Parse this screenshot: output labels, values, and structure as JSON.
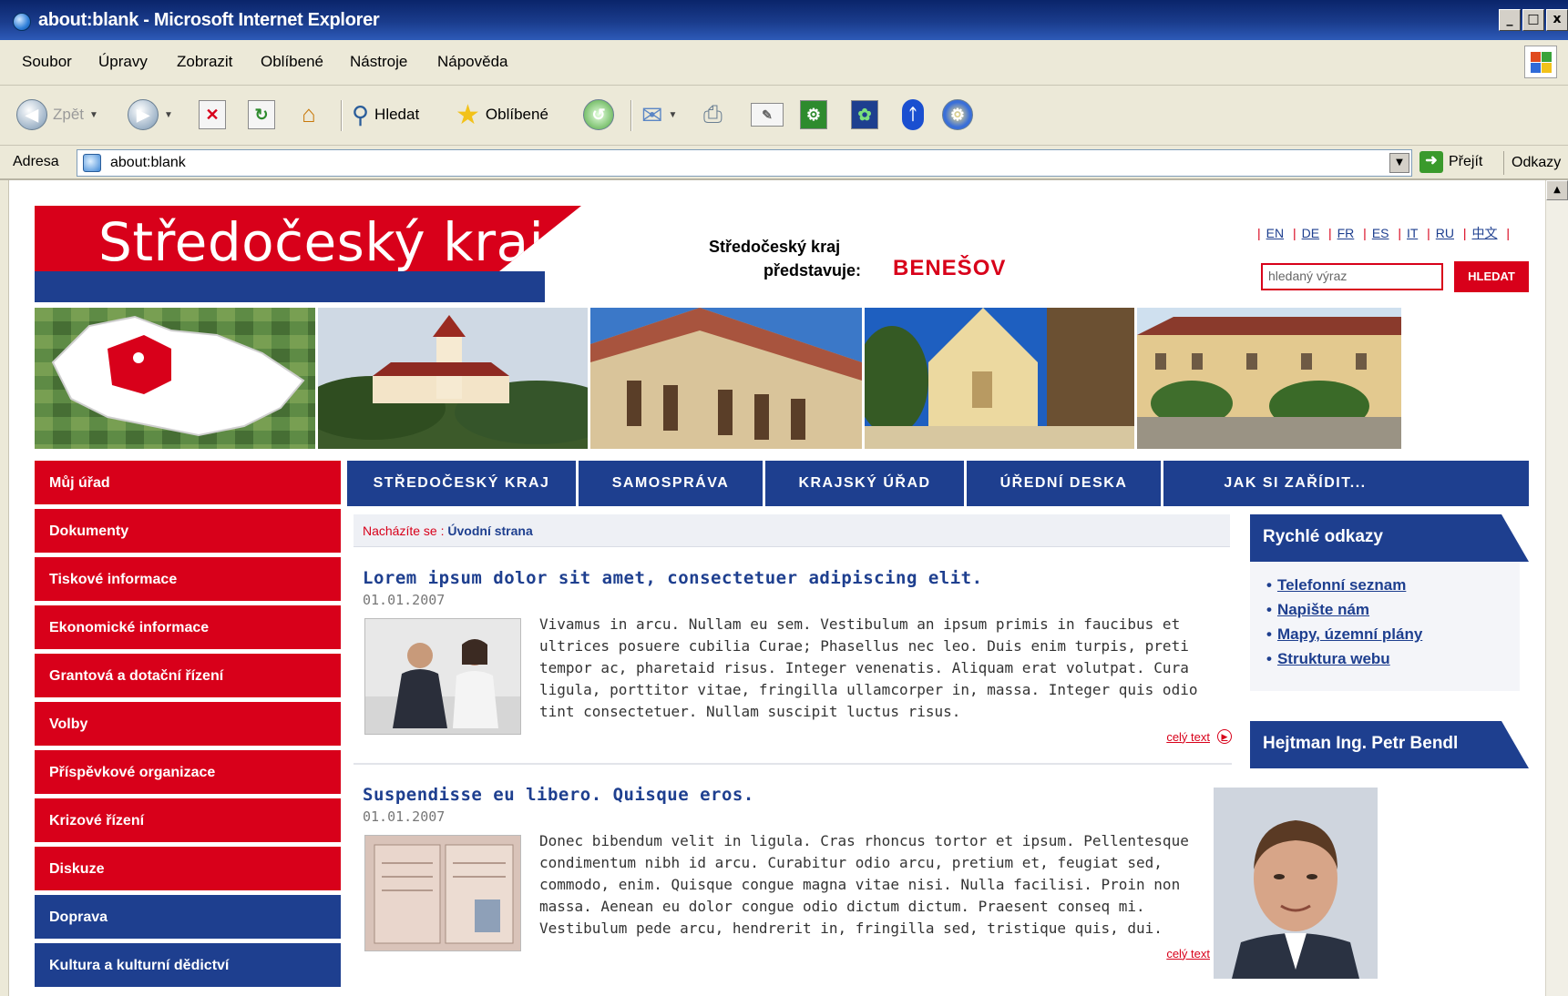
{
  "window": {
    "title": "about:blank - Microsoft Internet Explorer",
    "controls": [
      "_",
      "□",
      "x"
    ]
  },
  "menu": [
    "Soubor",
    "Úpravy",
    "Zobrazit",
    "Oblíbené",
    "Nástroje",
    "Nápověda"
  ],
  "toolbar": {
    "back_label": "Zpět",
    "search_label": "Hledat",
    "favorites_label": "Oblíbené"
  },
  "address": {
    "label": "Adresa",
    "value": "about:blank",
    "go_label": "Přejít",
    "links_label": "Odkazy"
  },
  "site": {
    "logo_text": "Středočeský kraj",
    "presents_line1": "Středočeský kraj",
    "presents_line2": "představuje:",
    "city": "BENEŠOV",
    "languages": [
      "EN",
      "DE",
      "FR",
      "ES",
      "IT",
      "RU",
      "中文"
    ],
    "search_placeholder": "hledaný výraz",
    "search_button": "HLEDAT",
    "left_nav": [
      {
        "label": "Můj úřad",
        "color": "red"
      },
      {
        "label": "Dokumenty",
        "color": "red"
      },
      {
        "label": "Tiskové informace",
        "color": "red"
      },
      {
        "label": "Ekonomické informace",
        "color": "red"
      },
      {
        "label": "Grantová a dotační řízení",
        "color": "red"
      },
      {
        "label": "Volby",
        "color": "red"
      },
      {
        "label": "Příspěvkové organizace",
        "color": "red"
      },
      {
        "label": "Krizové řízení",
        "color": "red"
      },
      {
        "label": "Diskuze",
        "color": "red"
      },
      {
        "label": "Doprava",
        "color": "blue"
      },
      {
        "label": "Kultura a kulturní dědictví",
        "color": "blue"
      }
    ],
    "top_nav": [
      "STŘEDOČESKÝ KRAJ",
      "SAMOSPRÁVA",
      "KRAJSKÝ ÚŘAD",
      "ÚŘEDNÍ DESKA",
      "JAK SI ZAŘÍDIT..."
    ],
    "breadcrumb": {
      "label": "Nacházíte se :",
      "current": "Úvodní strana"
    },
    "articles": [
      {
        "title": "Lorem ipsum dolor sit amet, consectetuer adipiscing elit.",
        "date": "01.01.2007",
        "text": "Vivamus in arcu. Nullam eu sem. Vestibulum an ipsum primis in faucibus et ultrices posuere cubilia Curae; Phasellus nec leo. Duis enim turpis, preti tempor ac, pharetaid risus. Integer venenatis. Aliquam erat volutpat. Cura ligula, porttitor vitae, fringilla ullamcorper in, massa. Integer quis odio tint consectetuer. Nullam suscipit luctus risus.",
        "more": "celý text"
      },
      {
        "title": "Suspendisse eu libero. Quisque eros.",
        "date": "01.01.2007",
        "text": "Donec bibendum velit in ligula. Cras rhoncus tortor et ipsum. Pellentesque condimentum nibh id arcu. Curabitur odio arcu, pretium et, feugiat sed, commodo, enim. Quisque congue magna vitae nisi. Nulla facilisi. Proin non massa. Aenean eu dolor congue odio dictum dictum. Praesent conseq mi. Vestibulum pede arcu, hendrerit in, fringilla sed, tristique quis, dui.",
        "more": "celý text"
      }
    ],
    "quick_links_title": "Rychlé odkazy",
    "quick_links": [
      "Telefonní seznam",
      "Napište nám",
      "Mapy, územní plány",
      "Struktura webu"
    ],
    "governor_title": "Hejtman Ing. Petr Bendl"
  },
  "colors": {
    "red": "#d8001a",
    "blue": "#1e3f8f"
  }
}
